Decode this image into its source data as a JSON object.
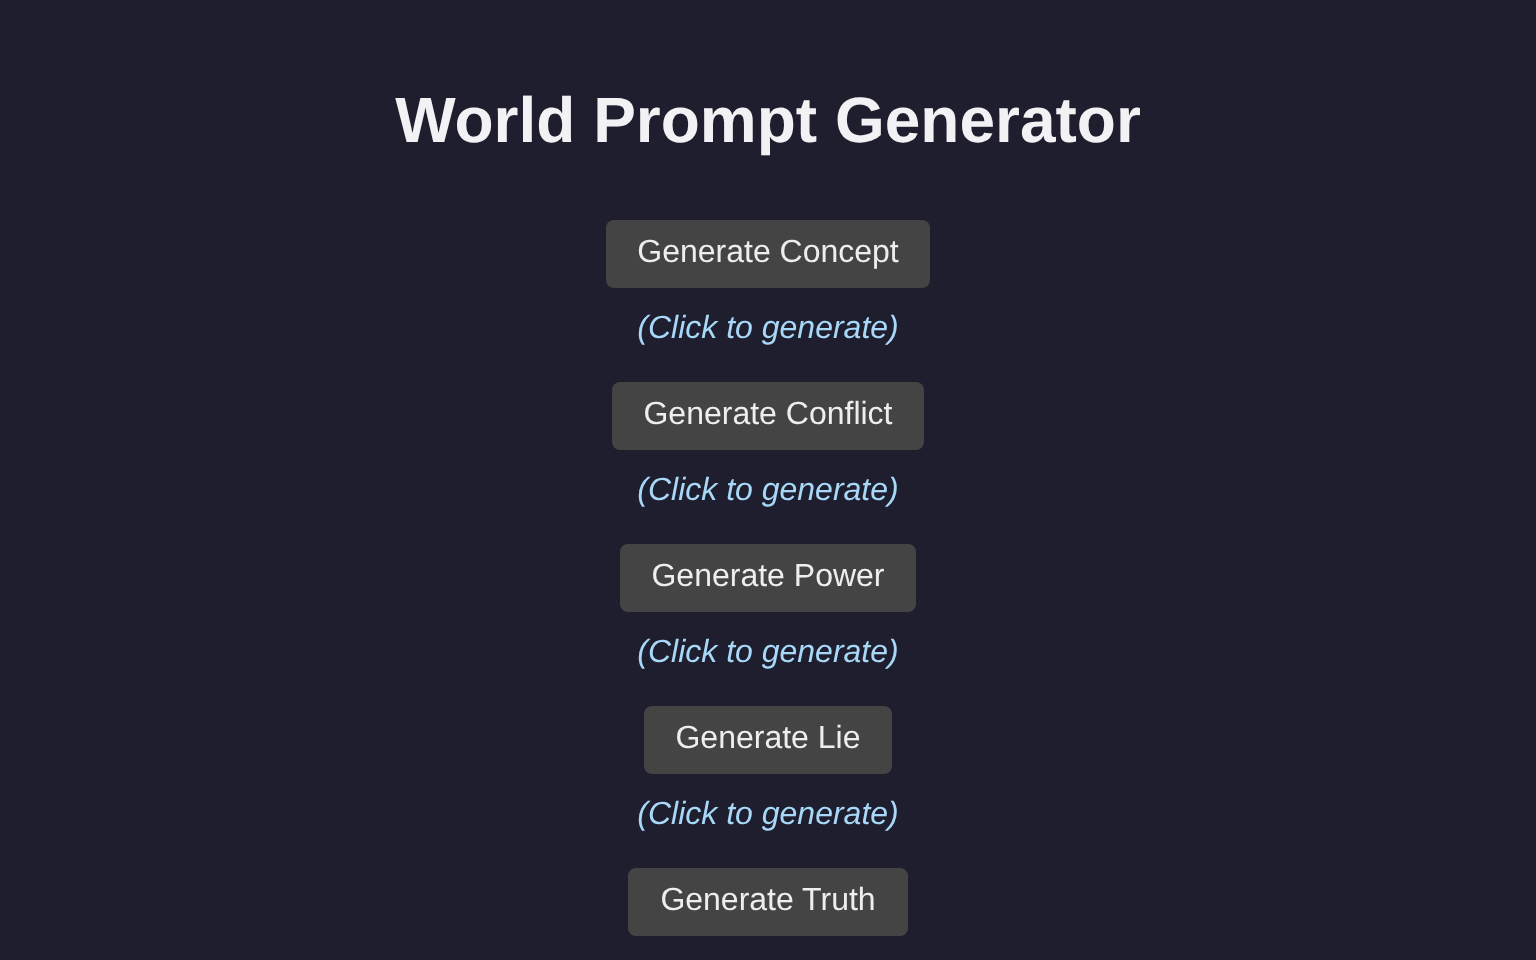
{
  "title": "World Prompt Generator",
  "generators": [
    {
      "button": "Generate Concept",
      "result": "(Click to generate)"
    },
    {
      "button": "Generate Conflict",
      "result": "(Click to generate)"
    },
    {
      "button": "Generate Power",
      "result": "(Click to generate)"
    },
    {
      "button": "Generate Lie",
      "result": "(Click to generate)"
    },
    {
      "button": "Generate Truth"
    }
  ]
}
